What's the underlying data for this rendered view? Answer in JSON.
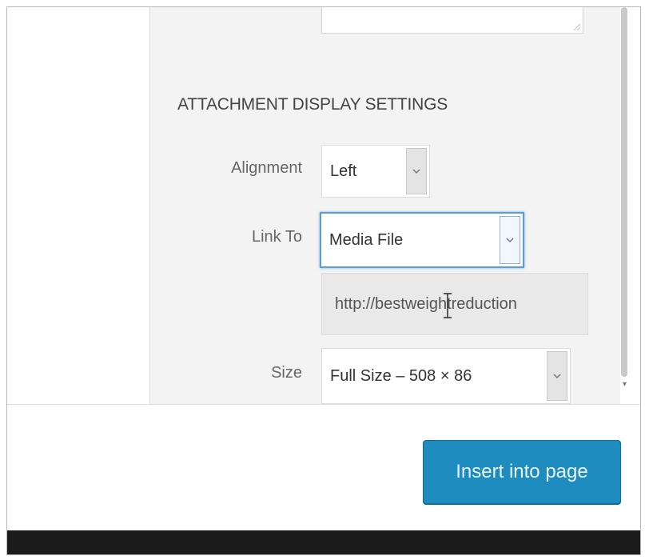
{
  "settings": {
    "section_title": "ATTACHMENT DISPLAY SETTINGS",
    "alignment": {
      "label": "Alignment",
      "value": "Left"
    },
    "link_to": {
      "label": "Link To",
      "value": "Media File",
      "url": "http://bestweightreduction"
    },
    "size": {
      "label": "Size",
      "value": "Full Size – 508 × 86"
    }
  },
  "footer": {
    "insert_button": "Insert into page"
  },
  "icons": {
    "select_arrow": "chevron-down-icon",
    "text_cursor": "text-cursor-icon",
    "resize": "resize-grip-icon"
  },
  "colors": {
    "accent": "#1e8cbe",
    "focus": "#5b9dd9",
    "panel_bg": "#f3f3f3"
  }
}
